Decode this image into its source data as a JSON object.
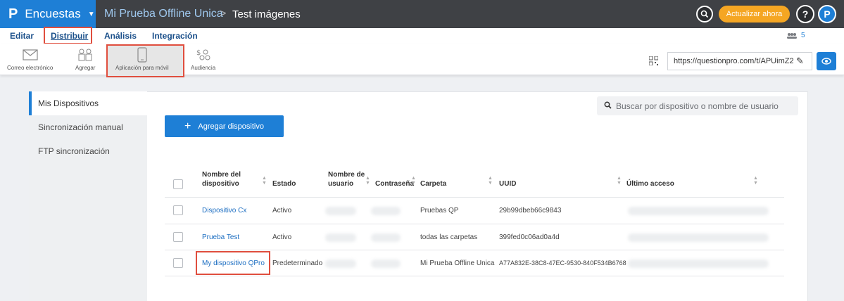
{
  "topbar": {
    "logo": "P",
    "product": "Encuestas",
    "survey_name": "Mi Prueba Offline Unica",
    "separator": ">",
    "page": "Test imágenes",
    "update_label": "Actualizar ahora",
    "help_label": "?",
    "user_label": "P",
    "search_icon_char": "⚲"
  },
  "menu": {
    "items": [
      {
        "label": "Editar"
      },
      {
        "label": "Distribuir"
      },
      {
        "label": "Análisis"
      },
      {
        "label": "Integración"
      }
    ],
    "users_count": "5"
  },
  "toolbar": {
    "tools": [
      {
        "label": "Correo electrónico",
        "icon": "envelope-icon"
      },
      {
        "label": "Agregar",
        "icon": "people-icon"
      },
      {
        "label": "Aplicación para móvil",
        "icon": "mobile-icon"
      },
      {
        "label": "Audiencia",
        "icon": "audience-icon"
      }
    ],
    "url": "https://questionpro.com/t/APUimZ2"
  },
  "sidebar": {
    "items": [
      {
        "label": "Mis Dispositivos"
      },
      {
        "label": "Sincronización manual"
      },
      {
        "label": "FTP sincronización"
      }
    ]
  },
  "main": {
    "add_button": "Agregar dispositivo",
    "search_placeholder": "Buscar por dispositivo o nombre de usuario",
    "table": {
      "headers": {
        "name_line1": "Nombre del",
        "name_line2": "dispositivo",
        "status": "Estado",
        "user_line1": "Nombre de",
        "user_line2": "usuario",
        "password": "Contraseña",
        "folder": "Carpeta",
        "uuid": "UUID",
        "last_access": "Último acceso"
      },
      "rows": [
        {
          "name": "Dispositivo Cx",
          "status": "Activo",
          "folder": "Pruebas QP",
          "uuid": "29b99dbeb66c9843"
        },
        {
          "name": "Prueba Test",
          "status": "Activo",
          "folder": "todas las carpetas",
          "uuid": "399fed0c06ad0a4d"
        },
        {
          "name": "My dispositivo QPro",
          "status": "Predeterminado",
          "folder": "Mi Prueba Offline Unica",
          "uuid": "A77A832E-38C8-47EC-9530-840F534B6768"
        }
      ]
    }
  },
  "colors": {
    "brand_blue": "#1e7fd6",
    "update_orange": "#f5a623",
    "highlight_red": "#e04e3e",
    "topbar": "#3f4145"
  }
}
